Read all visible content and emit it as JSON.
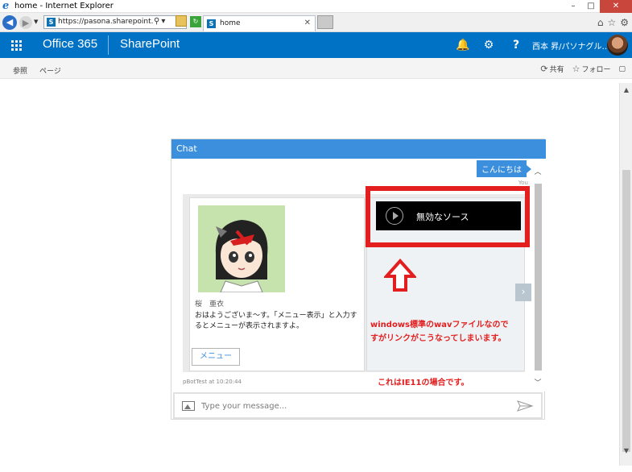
{
  "window": {
    "title": "home - Internet Explorer",
    "controls": {
      "minimize": "–",
      "maximize": "□",
      "close": "✕"
    }
  },
  "addressbar": {
    "url": "https://pasona.sharepoint.com/s",
    "tab_title": "home",
    "tab_close": "✕"
  },
  "suitebar": {
    "brand": "Office 365",
    "product": "SharePoint",
    "username": "西本 昇/パソナグル…",
    "bell_icon": "🔔",
    "gear_icon": "⚙",
    "help_icon": "?"
  },
  "ribbon": {
    "tabs": [
      "参照",
      "ページ"
    ],
    "actions": [
      "共有",
      "フォロー"
    ]
  },
  "chat": {
    "header": "Chat",
    "user_message": "こんにちは",
    "you_label": "You",
    "card": {
      "name": "桜　亜衣",
      "text": "おはようございま～す。「メニュー表示」と入力するとメニューが表示されますよ。",
      "button": "メニュー"
    },
    "video_text": "無効なソース",
    "annotation_1": "windows標準のwavファイルなのですがリンクがこうなってしまいます。",
    "annotation_2": "これはIE11の場合です。",
    "timestamp": "pBotTest at 10:20:44",
    "input_placeholder": "Type your message...",
    "next_glyph": "›"
  },
  "colors": {
    "suitebar": "#0072c6",
    "chat_header": "#3c8fdd",
    "annotation": "#e31e1e"
  }
}
